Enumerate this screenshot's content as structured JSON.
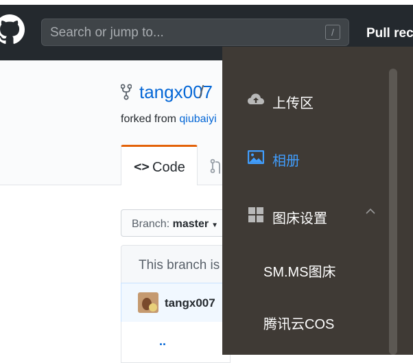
{
  "header": {
    "search_placeholder": "Search or jump to...",
    "slash_key": "/",
    "pull_requests": "Pull rec"
  },
  "repo": {
    "owner": "tangx007",
    "separator": "/",
    "forked_prefix": "forked from",
    "forked_link": "qiubaiyi"
  },
  "tabs": {
    "code_icon": "<>",
    "code_label": "Code"
  },
  "branch": {
    "label": "Branch:",
    "name": "master",
    "status_text": "This branch is"
  },
  "commit": {
    "user": "tangx007"
  },
  "files": {
    "parent_dir": ".."
  },
  "drawer": {
    "colors": {
      "background": "#3f3a35",
      "active": "#409eff",
      "text": "#ffffff"
    },
    "items": [
      {
        "icon": "cloud-upload-icon",
        "label": "上传区",
        "active": false
      },
      {
        "icon": "image-icon",
        "label": "相册",
        "active": true
      },
      {
        "icon": "grid-icon",
        "label": "图床设置",
        "active": false,
        "expanded": true,
        "children": [
          {
            "label": "SM.MS图床"
          },
          {
            "label": "腾讯云COS"
          }
        ]
      }
    ]
  }
}
